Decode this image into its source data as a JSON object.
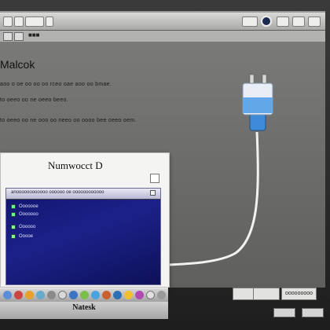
{
  "document": {
    "title": "Malcok",
    "lines": [
      "aoo o oe oo oo oo rceo oae aoo oo bmae.",
      "to oeeo oo ne oeeo beeo.",
      "to oeeo oo ne ooo oo neeo oo oooo bee oeeo oem."
    ]
  },
  "dialog": {
    "title": "Numwocct D",
    "inner": {
      "header": "anoooooooooooo oooooo oe oooooooooooo",
      "rows": [
        "Ooooooe",
        "Ooooooo",
        "Oooooo",
        "Ooooe"
      ]
    }
  },
  "bottom": {
    "brand": "Natesk",
    "right_control": "ooooooooo"
  },
  "colors": {
    "screen": "#6f6f6d",
    "dialog_inner": "#141877",
    "cable_connector": "#3f8bd9"
  },
  "icons": [
    "search-icon",
    "window-icon",
    "gear-icon",
    "folder-icon",
    "close-icon"
  ]
}
